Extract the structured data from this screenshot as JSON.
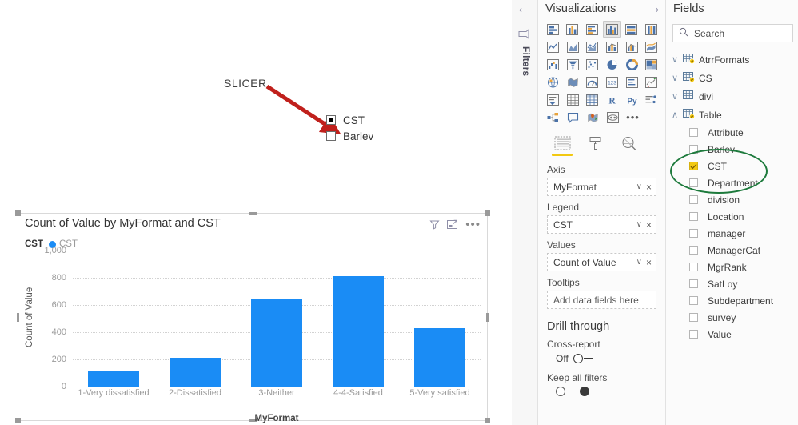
{
  "annotation": {
    "slicer_label": "SLICER",
    "arrow_color": "#c0201c",
    "ellipse_color": "#1d7a3c"
  },
  "slicer": {
    "items": [
      {
        "label": "CST",
        "checked": true
      },
      {
        "label": "Barlev",
        "checked": false
      }
    ]
  },
  "visual": {
    "title": "Count of Value by MyFormat and CST",
    "icons": [
      {
        "name": "filter-icon"
      },
      {
        "name": "focus-mode-icon"
      },
      {
        "name": "more-options-icon",
        "glyph": "•••"
      }
    ],
    "legend_title": "CST",
    "legend_entry": "CST"
  },
  "chart_data": {
    "type": "bar",
    "title": "Count of Value by MyFormat and CST",
    "categories": [
      "1-Very dissatisfied",
      "2-Dissatisfied",
      "3-Neither",
      "4-4-Satisfied",
      "5-Very satisfied"
    ],
    "values": [
      110,
      210,
      650,
      810,
      430
    ],
    "series": [
      {
        "name": "CST",
        "color": "#1a8cf5",
        "values": [
          110,
          210,
          650,
          810,
          430
        ]
      }
    ],
    "xlabel": "MyFormat",
    "ylabel": "Count of Value",
    "ylim": [
      0,
      1000
    ],
    "yticks": [
      0,
      200,
      400,
      600,
      800,
      1000
    ],
    "ytick_labels": [
      "0",
      "200",
      "400",
      "600",
      "800",
      "1,000"
    ],
    "grid": true,
    "legend": "top-left"
  },
  "filters_rail": {
    "collapse_label": "‹",
    "title": "Filters"
  },
  "visualizations": {
    "title": "Visualizations",
    "gallery_rows": [
      [
        "stacked-bar-chart-icon",
        "stacked-column-chart-icon",
        "clustered-bar-chart-icon",
        "clustered-column-chart-icon",
        "100-stacked-bar-chart-icon",
        "100-stacked-column-chart-icon"
      ],
      [
        "line-chart-icon",
        "area-chart-icon",
        "stacked-area-chart-icon",
        "line-stacked-column-chart-icon",
        "line-clustered-column-chart-icon",
        "ribbon-chart-icon"
      ],
      [
        "waterfall-chart-icon",
        "funnel-chart-icon",
        "scatter-chart-icon",
        "pie-chart-icon",
        "donut-chart-icon",
        "treemap-icon"
      ],
      [
        "map-icon",
        "filled-map-icon",
        "gauge-icon",
        "card-icon",
        "multi-row-card-icon",
        "kpi-icon"
      ],
      [
        "slicer-icon",
        "table-icon",
        "matrix-icon",
        "r-script-visual-icon",
        "python-visual-icon",
        "key-influencers-icon"
      ],
      [
        "decomposition-tree-icon",
        "qna-icon",
        "arcgis-map-icon",
        "paginated-report-icon",
        "more-visuals-icon"
      ]
    ],
    "selected_gallery_index": 3,
    "tabs": [
      {
        "name": "fields-tab",
        "icon": "fields-icon",
        "selected": true
      },
      {
        "name": "format-tab",
        "icon": "paint-roller-icon",
        "selected": false
      },
      {
        "name": "analytics-tab",
        "icon": "magnifier-icon",
        "selected": false
      }
    ],
    "active_tab_label": "Axis",
    "wells": [
      {
        "label": "Axis",
        "value": "MyFormat",
        "empty": false
      },
      {
        "label": "Legend",
        "value": "CST",
        "empty": false
      },
      {
        "label": "Values",
        "value": "Count of Value",
        "empty": false
      },
      {
        "label": "Tooltips",
        "value": "Add data fields here",
        "empty": true
      }
    ],
    "drill_through": {
      "title": "Drill through",
      "cross_report_label": "Cross-report",
      "cross_report_state": "Off",
      "keep_all_filters_label": "Keep all filters"
    }
  },
  "fields": {
    "title": "Fields",
    "search_placeholder": "Search",
    "tables": [
      {
        "name": "AtrrFormats",
        "expanded": false,
        "badge": true
      },
      {
        "name": "CS",
        "expanded": false,
        "badge": true
      },
      {
        "name": "divi",
        "expanded": false,
        "badge": false
      },
      {
        "name": "Table",
        "expanded": true,
        "badge": true
      }
    ],
    "table_fields": [
      {
        "name": "Attribute",
        "checked": false
      },
      {
        "name": "Barlev",
        "checked": false
      },
      {
        "name": "CST",
        "checked": true
      },
      {
        "name": "Department",
        "checked": false
      },
      {
        "name": "division",
        "checked": false
      },
      {
        "name": "Location",
        "checked": false
      },
      {
        "name": "manager",
        "checked": false
      },
      {
        "name": "ManagerCat",
        "checked": false
      },
      {
        "name": "MgrRank",
        "checked": false
      },
      {
        "name": "SatLoy",
        "checked": false
      },
      {
        "name": "Subdepartment",
        "checked": false
      },
      {
        "name": "survey",
        "checked": false
      },
      {
        "name": "Value",
        "checked": false
      }
    ]
  }
}
